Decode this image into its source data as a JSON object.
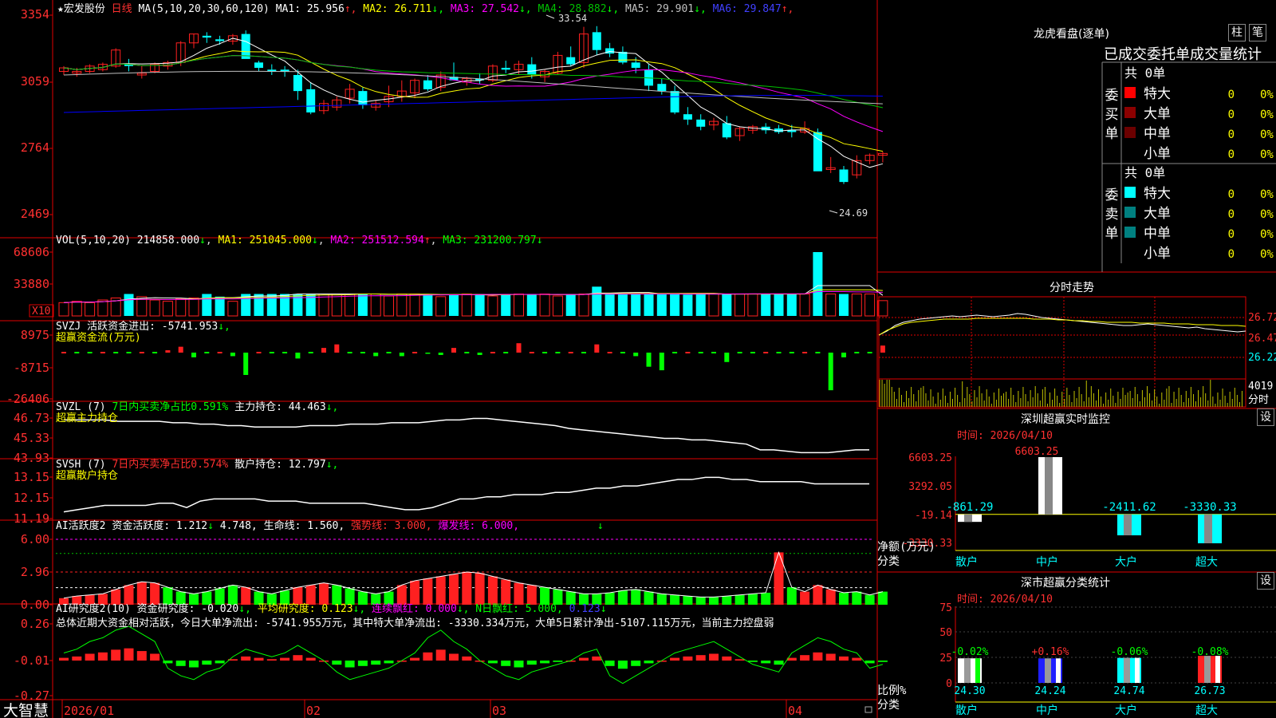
{
  "stock": {
    "name": "宏发股份",
    "period": "日线",
    "star": "★"
  },
  "colors": {
    "up": "#ff2020",
    "down": "#00ffff",
    "ma1": "#ffffff",
    "ma2": "#ffff00",
    "ma3": "#ff00ff",
    "ma4": "#00c000",
    "ma5": "#c0c0c0",
    "ma6": "#0000ff"
  },
  "main_chart": {
    "ma_label": "MA(5,10,20,30,60,120)",
    "ma_values": [
      {
        "label": "MA1: 25.956",
        "arrow": "↑",
        "color": "#ffffff"
      },
      {
        "label": "MA2: 26.711",
        "arrow": "↓",
        "color": "#ffff00"
      },
      {
        "label": "MA3: 27.542",
        "arrow": "↓",
        "color": "#ff00ff"
      },
      {
        "label": "MA4: 28.882",
        "arrow": "↓",
        "color": "#00c000"
      },
      {
        "label": "MA5: 29.901",
        "arrow": "↓",
        "color": "#c0c0c0"
      },
      {
        "label": "MA6: 29.847",
        "arrow": "↑",
        "color": "#4040ff"
      }
    ],
    "y_ticks": [
      "3354",
      "3059",
      "2764",
      "2469"
    ],
    "high_label": "33.54",
    "low_label": "24.69"
  },
  "chart_data": [
    {
      "type": "candlestick",
      "title": "宏发股份 日线",
      "x_labels": [
        "2026/01",
        "02",
        "03",
        "04"
      ],
      "ohlc": [
        [
          31.0,
          31.3,
          30.8,
          31.2
        ],
        [
          30.9,
          31.2,
          30.7,
          31.0
        ],
        [
          31.0,
          31.4,
          30.9,
          31.3
        ],
        [
          31.1,
          31.5,
          31.0,
          31.4
        ],
        [
          31.3,
          32.3,
          31.2,
          32.2
        ],
        [
          31.4,
          31.7,
          31.0,
          31.3
        ],
        [
          30.8,
          31.3,
          30.6,
          30.9
        ],
        [
          31.0,
          31.5,
          30.9,
          31.4
        ],
        [
          31.3,
          31.6,
          31.1,
          31.5
        ],
        [
          31.5,
          32.7,
          31.3,
          32.6
        ],
        [
          32.6,
          33.1,
          32.3,
          33.1
        ],
        [
          33.0,
          33.2,
          32.6,
          32.9
        ],
        [
          32.8,
          33.0,
          32.5,
          32.7
        ],
        [
          32.7,
          33.1,
          32.5,
          33.0
        ],
        [
          33.1,
          33.3,
          31.8,
          31.7
        ],
        [
          31.5,
          31.6,
          31.0,
          31.2
        ],
        [
          31.1,
          31.4,
          30.8,
          31.0
        ],
        [
          31.1,
          31.3,
          30.7,
          31.0
        ],
        [
          30.8,
          31.1,
          29.4,
          29.9
        ],
        [
          30.0,
          30.4,
          28.6,
          28.7
        ],
        [
          28.8,
          29.4,
          28.6,
          29.2
        ],
        [
          29.0,
          29.6,
          28.8,
          29.4
        ],
        [
          29.5,
          30.3,
          29.2,
          30.0
        ],
        [
          29.9,
          30.1,
          28.9,
          29.1
        ],
        [
          29.0,
          29.4,
          28.8,
          29.2
        ],
        [
          29.3,
          30.2,
          29.0,
          29.6
        ],
        [
          29.6,
          30.5,
          29.3,
          29.9
        ],
        [
          29.8,
          30.6,
          29.5,
          30.5
        ],
        [
          30.5,
          30.8,
          29.9,
          30.0
        ],
        [
          30.1,
          31.0,
          29.9,
          30.8
        ],
        [
          30.7,
          31.5,
          30.5,
          30.5
        ],
        [
          30.4,
          30.7,
          30.2,
          30.6
        ],
        [
          30.6,
          30.9,
          30.3,
          30.5
        ],
        [
          30.5,
          31.4,
          30.4,
          31.3
        ],
        [
          31.2,
          31.6,
          30.9,
          31.1
        ],
        [
          31.1,
          31.6,
          30.8,
          31.4
        ],
        [
          31.4,
          31.8,
          30.6,
          30.8
        ],
        [
          30.7,
          31.1,
          30.4,
          31.0
        ],
        [
          30.9,
          32.1,
          30.8,
          31.9
        ],
        [
          31.8,
          32.4,
          31.3,
          31.4
        ],
        [
          31.5,
          33.5,
          31.2,
          33.1
        ],
        [
          33.2,
          33.54,
          31.9,
          32.2
        ],
        [
          32.3,
          32.6,
          31.8,
          32.0
        ],
        [
          32.1,
          32.4,
          31.4,
          31.5
        ],
        [
          31.5,
          31.8,
          30.9,
          31.2
        ],
        [
          31.1,
          31.4,
          29.9,
          30.2
        ],
        [
          30.3,
          30.6,
          29.7,
          29.9
        ],
        [
          29.9,
          30.2,
          28.6,
          28.7
        ],
        [
          28.6,
          29.0,
          28.0,
          28.3
        ],
        [
          28.3,
          28.6,
          27.7,
          27.9
        ],
        [
          28.0,
          28.4,
          27.7,
          28.2
        ],
        [
          28.1,
          28.5,
          27.2,
          27.3
        ],
        [
          27.4,
          27.9,
          27.1,
          27.8
        ],
        [
          27.7,
          28.0,
          27.5,
          27.9
        ],
        [
          27.9,
          28.1,
          27.5,
          27.7
        ],
        [
          27.8,
          28.0,
          27.5,
          27.6
        ],
        [
          27.7,
          28.0,
          27.3,
          27.6
        ],
        [
          27.6,
          28.2,
          27.5,
          27.8
        ],
        [
          27.6,
          27.8,
          25.5,
          25.4
        ],
        [
          25.5,
          26.2,
          25.3,
          25.6
        ],
        [
          25.5,
          25.7,
          24.69,
          24.8
        ],
        [
          25.2,
          26.3,
          25.0,
          26.0
        ],
        [
          26.0,
          26.4,
          25.8,
          26.3
        ],
        [
          26.3,
          26.5,
          25.9,
          26.4
        ]
      ],
      "ylim": [
        24.0,
        34.2
      ]
    },
    {
      "type": "bar",
      "title": "VOL(5,10,20)",
      "x": "days",
      "values": [
        20,
        22,
        20,
        24,
        27,
        33,
        29,
        24,
        22,
        26,
        27,
        33,
        29,
        22,
        33,
        33,
        33,
        33,
        33,
        33,
        33,
        33,
        33,
        33,
        33,
        30,
        33,
        33,
        33,
        29,
        32,
        33,
        33,
        30,
        33,
        33,
        33,
        33,
        30,
        32,
        33,
        44,
        33,
        33,
        33,
        33,
        33,
        33,
        32,
        33,
        33,
        33,
        33,
        33,
        33,
        33,
        33,
        33,
        96,
        33,
        33,
        33,
        33,
        23
      ]
    },
    {
      "type": "bar",
      "title": "SVZJ 活跃资金进出",
      "values": [
        0,
        0,
        0,
        0,
        0,
        0,
        0,
        0,
        2,
        5,
        -4,
        0,
        0,
        -3,
        -19,
        0,
        0,
        0,
        -5,
        0,
        4,
        7,
        0,
        0,
        -3,
        0,
        -3,
        0,
        -1,
        -2,
        4,
        0,
        -2,
        0,
        0,
        8,
        0,
        0,
        0,
        0,
        0,
        7,
        0,
        0,
        -3,
        -12,
        -15,
        0,
        0,
        0,
        0,
        -8,
        0,
        0,
        0,
        0,
        0,
        0,
        0,
        -32,
        -4,
        0,
        0,
        6
      ]
    },
    {
      "type": "line",
      "title": "主力持仓",
      "values": [
        46.6,
        46.6,
        46.6,
        46.6,
        46.5,
        46.5,
        46.5,
        46.5,
        46.4,
        46.4,
        46.3,
        46.3,
        46.2,
        46.2,
        46.1,
        46.1,
        46.1,
        46.1,
        46.2,
        46.2,
        46.2,
        46.3,
        46.3,
        46.3,
        46.4,
        46.4,
        46.4,
        46.5,
        46.6,
        46.6,
        46.7,
        46.7,
        46.6,
        46.5,
        46.4,
        46.3,
        46.2,
        46.0,
        45.9,
        45.8,
        45.7,
        45.6,
        45.5,
        45.4,
        45.3,
        45.3,
        45.2,
        45.2,
        45.1,
        45.0,
        44.9,
        44.5,
        44.5,
        44.4,
        44.3,
        44.3,
        44.3,
        44.4,
        44.5,
        44.5
      ]
    },
    {
      "type": "line",
      "title": "散户持仓",
      "values": [
        11.5,
        11.6,
        11.7,
        11.8,
        11.8,
        11.8,
        11.8,
        11.9,
        11.9,
        11.7,
        12.0,
        12.1,
        12.1,
        12.1,
        12.1,
        12.0,
        12.0,
        12.0,
        11.9,
        11.9,
        11.9,
        11.9,
        11.9,
        11.8,
        11.7,
        11.6,
        11.6,
        11.7,
        11.9,
        12.1,
        12.1,
        12.2,
        12.2,
        12.3,
        12.3,
        12.3,
        12.4,
        12.4,
        12.5,
        12.6,
        12.6,
        12.7,
        12.7,
        12.8,
        12.9,
        13.0,
        13.0,
        13.1,
        13.1,
        13.0,
        13.0,
        12.9,
        12.9,
        12.9,
        12.9,
        12.8,
        12.8,
        12.8,
        12.8,
        12.8
      ]
    },
    {
      "type": "bar",
      "title": "AI活跃度2",
      "values": [
        0.6,
        0.8,
        0.9,
        1.0,
        1.4,
        1.8,
        2.1,
        2.0,
        1.6,
        1.2,
        1.0,
        1.2,
        1.5,
        1.8,
        1.6,
        1.2,
        1.0,
        1.3,
        1.6,
        1.8,
        2.0,
        1.8,
        1.5,
        1.2,
        1.0,
        1.2,
        1.8,
        2.2,
        2.4,
        2.6,
        2.8,
        3.0,
        2.9,
        2.6,
        2.3,
        2.0,
        1.8,
        1.6,
        1.4,
        1.2,
        1.0,
        1.0,
        1.1,
        1.3,
        1.4,
        1.2,
        1.0,
        0.9,
        0.8,
        0.7,
        0.7,
        0.8,
        0.9,
        1.0,
        1.1,
        4.8,
        1.6,
        1.2,
        1.8,
        1.4,
        1.1,
        1.2,
        0.9,
        1.2
      ]
    },
    {
      "type": "bar",
      "title": "AI研究度2",
      "values": [
        0.02,
        0.03,
        0.05,
        0.06,
        0.08,
        0.09,
        0.07,
        0.05,
        -0.02,
        -0.04,
        -0.05,
        -0.03,
        -0.02,
        0.01,
        0.03,
        0.02,
        0.01,
        0.02,
        0.04,
        0.02,
        0.0,
        -0.03,
        -0.05,
        -0.04,
        -0.03,
        -0.02,
        0.0,
        0.02,
        0.06,
        0.08,
        0.05,
        0.03,
        0.0,
        -0.02,
        -0.04,
        -0.05,
        -0.03,
        -0.02,
        -0.01,
        0.0,
        0.02,
        0.03,
        -0.04,
        -0.06,
        -0.04,
        -0.02,
        0.0,
        0.02,
        0.03,
        0.04,
        0.05,
        0.03,
        0.01,
        -0.01,
        -0.02,
        -0.03,
        0.02,
        0.04,
        0.06,
        0.05,
        0.03,
        0.02,
        -0.02,
        -0.01
      ]
    }
  ],
  "vol": {
    "title": "VOL(5,10,20)",
    "value": "214858.000",
    "arrow": "↓",
    "ma1": "MA1: 251045.000",
    "ma1_arrow": "↓",
    "ma2": "MA2: 251512.594",
    "ma2_arrow": "↑",
    "ma3": "MA3: 231200.797",
    "ma3_arrow": "↓",
    "y_ticks": [
      "68606",
      "33880"
    ],
    "unit": "X10"
  },
  "svzj": {
    "title": "SVZJ",
    "label": "活跃资金进出: -5741.953",
    "arrow": "↓,",
    "sub": "超赢资金流(万元)",
    "y_ticks": [
      "8975",
      "-8715",
      "-26406"
    ]
  },
  "svzl": {
    "title": "SVZL (7)",
    "net": "7日内买卖净占比0.591%",
    "holding": "主力持仓: 44.463",
    "arrow": "↓,",
    "sub": "超赢主力持仓",
    "y_ticks": [
      "46.73",
      "45.33",
      "43.93"
    ]
  },
  "svsh": {
    "title": "SVSH (7)",
    "net": "7日内买卖净占比0.574%",
    "holding": "散户持仓: 12.797",
    "arrow": "↓,",
    "sub": "超赢散户持仓",
    "y_ticks": [
      "13.15",
      "12.15",
      "11.19"
    ]
  },
  "ai_active": {
    "title": "AI活跃度2",
    "fund": "资金活跃度: 1.212",
    "arrow1": "↓",
    "v2": "4.748,",
    "life": "生命线: 1.560,",
    "strong": "强势线: 3.000,",
    "burst": "爆发线: 6.000,",
    "arrow2": "↓",
    "y_ticks": [
      "6.00",
      "2.96",
      "0.00"
    ]
  },
  "ai_research": {
    "title": "AI研究度2(10)",
    "fund": "资金研究度: -0.020",
    "a1": "↓,",
    "avg": "平均研究度: 0.123",
    "a2": "↓,",
    "red": "连续飘红: 0.000",
    "a3": "↓,",
    "nred": "N日飘红: 5.000,",
    "v": "0.123",
    "a4": "↓",
    "summary": "总体近期大资金相对活跃，今日大单净流出: -5741.955万元，其中特大单净流出: -3330.334万元，大单5日累计净出-5107.115万元，当前主力控盘弱",
    "y_ticks": [
      "0.26",
      "-0.01",
      "-0.27"
    ]
  },
  "x_axis": {
    "labels": [
      "2026/01",
      "02",
      "03",
      "04"
    ],
    "brand": "大智慧"
  },
  "dragon_tiger": {
    "title": "龙虎看盘(逐单)",
    "btn1": "柱",
    "btn2": "笔",
    "header": "已成交委托单成交量统计",
    "buy_label": "委买单",
    "buy_total": "共 0单",
    "sell_label": "委卖单",
    "sell_total": "共 0单",
    "buy_rows": [
      {
        "name": "特大",
        "count": "0",
        "pct": "0%",
        "color": "#ff0000"
      },
      {
        "name": "大单",
        "count": "0",
        "pct": "0%",
        "color": "#8b0000"
      },
      {
        "name": "中单",
        "count": "0",
        "pct": "0%",
        "color": "#6b0000"
      },
      {
        "name": "小单",
        "count": "0",
        "pct": "0%",
        "color": ""
      }
    ],
    "sell_rows": [
      {
        "name": "特大",
        "count": "0",
        "pct": "0%",
        "color": "#00ffff"
      },
      {
        "name": "大单",
        "count": "0",
        "pct": "0%",
        "color": "#008080"
      },
      {
        "name": "中单",
        "count": "0",
        "pct": "0%",
        "color": "#008080"
      },
      {
        "name": "小单",
        "count": "0",
        "pct": "0%",
        "color": ""
      }
    ]
  },
  "intraday": {
    "title": "分时走势",
    "y_ticks": [
      "26.72",
      "26.47",
      "26.22"
    ],
    "vol_tick": "4019",
    "vol_label": "分时",
    "price": [
      26.5,
      26.55,
      26.62,
      26.66,
      26.68,
      26.7,
      26.71,
      26.72,
      26.73,
      26.74,
      26.73,
      26.74,
      26.75,
      26.74,
      26.73,
      26.74,
      26.75,
      26.77,
      26.76,
      26.74,
      26.72,
      26.71,
      26.7,
      26.69,
      26.68,
      26.67,
      26.66,
      26.65,
      26.64,
      26.63,
      26.62,
      26.62,
      26.63,
      26.64,
      26.63,
      26.62,
      26.61,
      26.6,
      26.59,
      26.6,
      26.58,
      26.57,
      26.56,
      26.55,
      26.54,
      26.55
    ],
    "avg": [
      26.5,
      26.56,
      26.6,
      26.64,
      26.66,
      26.67,
      26.68,
      26.69,
      26.7,
      26.7,
      26.7,
      26.7,
      26.71,
      26.71,
      26.71,
      26.71,
      26.71,
      26.71,
      26.71,
      26.7,
      26.7,
      26.7,
      26.69,
      26.69,
      26.68,
      26.68,
      26.67,
      26.67,
      26.66,
      26.66,
      26.66,
      26.66,
      26.65,
      26.65,
      26.65,
      26.65,
      26.64,
      26.64,
      26.64,
      26.63,
      26.63,
      26.63,
      26.62,
      26.62,
      26.62,
      26.61
    ]
  },
  "sz_monitor": {
    "title": "深圳超赢实时监控",
    "btn": "设",
    "date": "时间: 2026/04/10",
    "top_value": "6603.25",
    "y_ticks": [
      "6603.25",
      "3292.05",
      "-19.14",
      "-3330.33"
    ],
    "y_unit": "净额(万元)",
    "x_unit": "分类",
    "cats": [
      {
        "name": "散户",
        "value": -861.29,
        "label": "-861.29",
        "color": "#ffffff"
      },
      {
        "name": "中户",
        "value": 6603.25,
        "label": "6603.25",
        "color": "#ffffff"
      },
      {
        "name": "大户",
        "value": -2411.62,
        "label": "-2411.62",
        "color": "#00ffff"
      },
      {
        "name": "超大",
        "value": -3330.33,
        "label": "-3330.33",
        "color": "#00ffff"
      }
    ]
  },
  "sz_stats": {
    "title": "深市超赢分类统计",
    "btn": "设",
    "date": "时间: 2026/04/10",
    "y_ticks": [
      "75",
      "50",
      "25",
      "0"
    ],
    "y_unit": "比例%",
    "x_unit": "分类",
    "cats": [
      {
        "name": "散户",
        "value": 24.3,
        "label": "24.30",
        "chg": "-0.02%",
        "color": "#ffffff",
        "accent": "#00ff00"
      },
      {
        "name": "中户",
        "value": 24.24,
        "label": "24.24",
        "chg": "+0.16%",
        "color": "#2020ff",
        "accent": "#ffffff"
      },
      {
        "name": "大户",
        "value": 24.74,
        "label": "24.74",
        "chg": "-0.06%",
        "color": "#00ffff",
        "accent": "#ffffff"
      },
      {
        "name": "超大",
        "value": 26.73,
        "label": "26.73",
        "chg": "-0.08%",
        "color": "#ff2020",
        "accent": "#ffffff"
      }
    ]
  }
}
